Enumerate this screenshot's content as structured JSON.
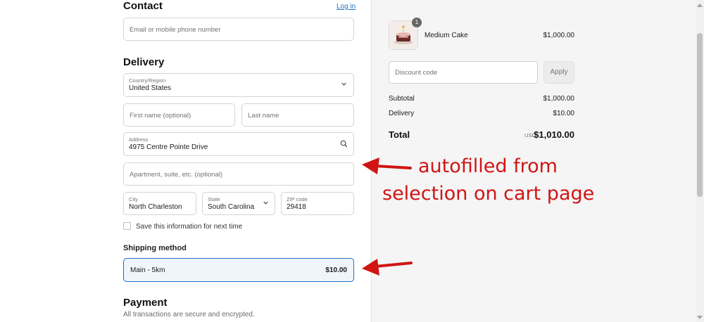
{
  "contact": {
    "heading": "Contact",
    "login_link": "Log in",
    "email_placeholder": "Email or mobile phone number"
  },
  "delivery": {
    "heading": "Delivery",
    "country_label": "Country/Region",
    "country_value": "United States",
    "first_name_placeholder": "First name (optional)",
    "last_name_placeholder": "Last name",
    "address_label": "Address",
    "address_value": "4975 Centre Pointe Drive",
    "apartment_placeholder": "Apartment, suite, etc. (optional)",
    "city_label": "City",
    "city_value": "North Charleston",
    "state_label": "State",
    "state_value": "South Carolina",
    "zip_label": "ZIP code",
    "zip_value": "29418",
    "save_info_label": "Save this information for next time"
  },
  "shipping": {
    "heading": "Shipping method",
    "option_name": "Main - 5km",
    "option_price": "$10.00"
  },
  "payment": {
    "heading": "Payment",
    "note": "All transactions are secure and encrypted."
  },
  "summary": {
    "item_name": "Medium Cake",
    "item_price": "$1,000.00",
    "item_qty": "1",
    "discount_placeholder": "Discount code",
    "apply_label": "Apply",
    "subtotal_label": "Subtotal",
    "subtotal_value": "$1,000.00",
    "delivery_label": "Delivery",
    "delivery_value": "$10.00",
    "total_label": "Total",
    "total_currency": "USD",
    "total_value": "$1,010.00"
  },
  "annotations": {
    "line1": "autofilled from",
    "line2": "selection on cart page"
  },
  "colors": {
    "accent": "#1f6fbf",
    "annotation": "#d11414",
    "summary_bg": "#f5f5f5"
  },
  "icons": {
    "select": "chevron-down-icon",
    "address": "search-icon"
  }
}
